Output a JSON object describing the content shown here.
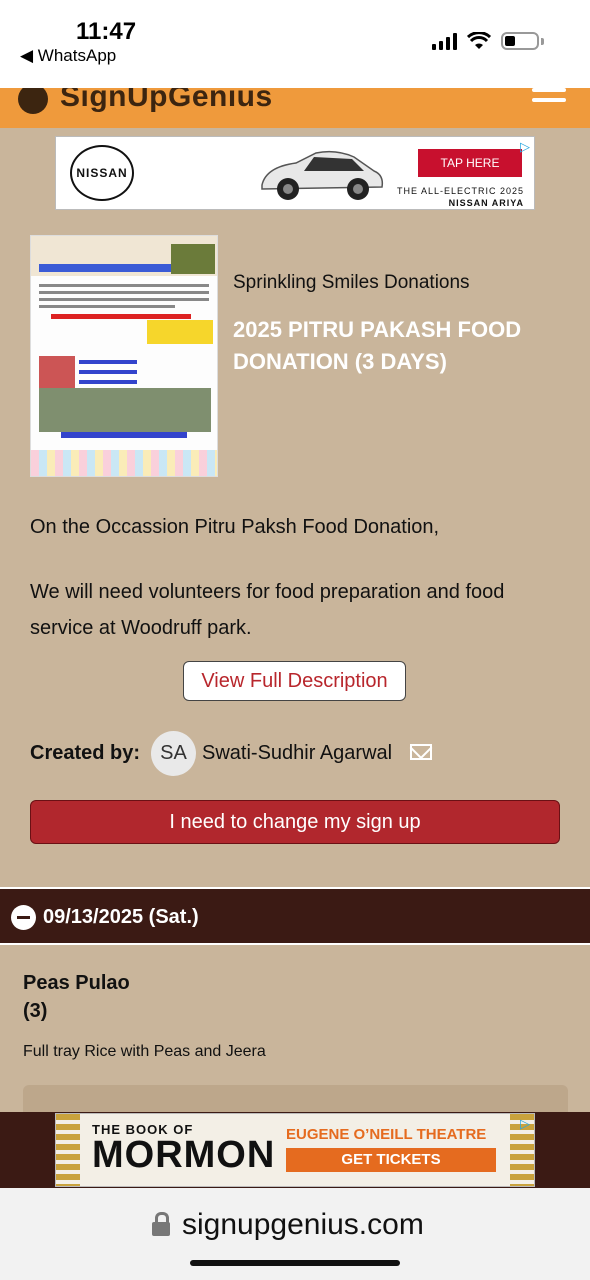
{
  "status": {
    "time": "11:47",
    "back_app": "◀ WhatsApp"
  },
  "header": {
    "logo": "SignUpGenius"
  },
  "top_ad": {
    "brand": "NISSAN",
    "cta": "TAP HERE",
    "tagline": "THE ALL-ELECTRIC 2025",
    "model": "NISSAN ARIYA"
  },
  "event": {
    "organization": "Sprinkling Smiles Donations",
    "title": "2025 PITRU PAKASH FOOD DONATION (3 DAYS)",
    "description_line1": "On the Occassion Pitru Paksh Food Donation,",
    "description_line2": "We will need volunteers for food preparation and food service at Woodruff park.",
    "view_full_label": "View Full Description",
    "created_by_label": "Created by:",
    "creator_initials": "SA",
    "creator_name": "Swati-Sudhir Agarwal",
    "change_signup_label": "I need to change my sign up"
  },
  "date_section": {
    "date": "09/13/2025 (Sat.)"
  },
  "item": {
    "name": "Peas Pulao",
    "quantity": "(3)",
    "description": "Full tray Rice with Peas and Jeera"
  },
  "bottom_ad": {
    "small_title": "THE BOOK OF",
    "big_title": "MORMON",
    "theatre": "EUGENE O’NEILL THEATRE",
    "cta": "GET TICKETS"
  },
  "browser": {
    "url": "signupgenius.com"
  },
  "colors": {
    "header_orange": "#ef9a3c",
    "button_red": "#b1272d",
    "date_bar": "#3b1a14"
  }
}
